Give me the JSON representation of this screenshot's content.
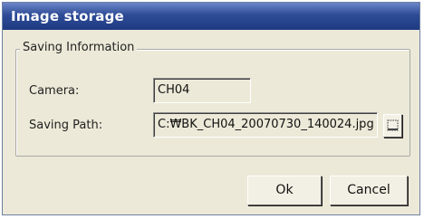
{
  "window": {
    "title": "Image storage"
  },
  "group": {
    "legend": "Saving Information"
  },
  "camera": {
    "label": "Camera:",
    "value": "CH04"
  },
  "saving_path": {
    "label": "Saving Path:",
    "value": "C:₩BK_CH04_20070730_140024.jpg"
  },
  "browse": {
    "icon": "browse-folder-icon"
  },
  "buttons": {
    "ok": "Ok",
    "cancel": "Cancel"
  },
  "colors": {
    "titlebar": "#2d4b96",
    "background": "#ece9d8"
  }
}
